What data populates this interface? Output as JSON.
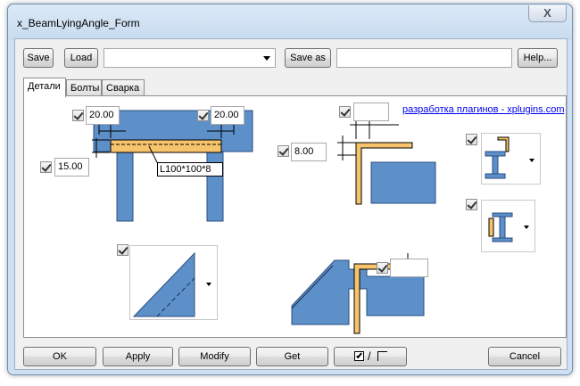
{
  "window": {
    "title": "x_BeamLyingAngle_Form",
    "close_glyph": "X"
  },
  "toolbar": {
    "save_label": "Save",
    "load_label": "Load",
    "preset_combo_value": "",
    "save_as_label": "Save as",
    "save_as_value": "",
    "help_label": "Help..."
  },
  "tabs": [
    {
      "label": "Детали",
      "active": true
    },
    {
      "label": "Болты",
      "active": false
    },
    {
      "label": "Сварка",
      "active": false
    }
  ],
  "details": {
    "top_left_offset": "20.00",
    "top_right_offset": "20.00",
    "vertical_offset": "15.00",
    "profile_label": "L100*100*8",
    "angle_gap": "8.00",
    "top_right_field": "",
    "bottom_right_field": "",
    "link_text": "разработка плагинов - xplugins.com"
  },
  "bottom": {
    "ok_label": "OK",
    "apply_label": "Apply",
    "modify_label": "Modify",
    "get_label": "Get",
    "toggle_label": "/",
    "cancel_label": "Cancel"
  },
  "colors": {
    "steel_blue": "#5d8fc9",
    "angle_orange": "#f7c36b",
    "window_frame": "#cfe0f2"
  }
}
